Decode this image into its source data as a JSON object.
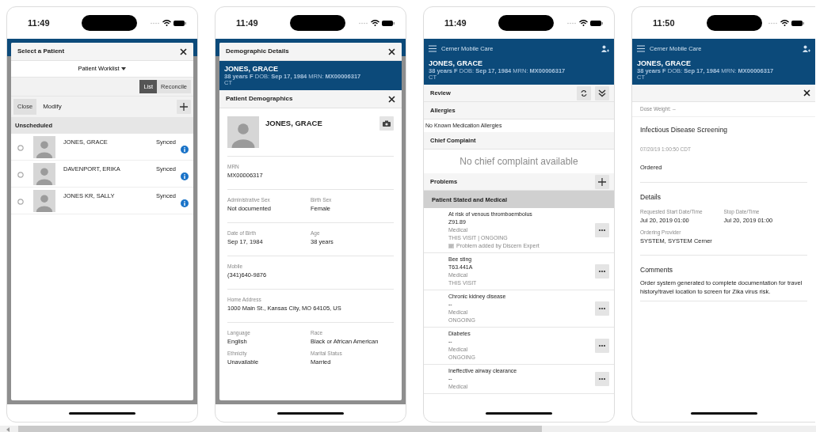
{
  "screens": [
    {
      "kind": "patient_select",
      "time": "11:49",
      "modal": {
        "title": "Select a Patient",
        "worklist": "Patient Worklist",
        "view_tabs": [
          {
            "label": "List",
            "selected": true
          },
          {
            "label": "Reconcile",
            "selected": false
          }
        ],
        "close": "Close",
        "modify": "Modify",
        "group": "Unscheduled",
        "patients": [
          {
            "name": "JONES, GRACE",
            "status": "Synced"
          },
          {
            "name": "DAVENPORT, ERIKA",
            "status": "Synced"
          },
          {
            "name": "JONES KR, SALLY",
            "status": "Synced"
          }
        ]
      }
    },
    {
      "kind": "demographics",
      "time": "11:49",
      "modal_title": "Demographic Details",
      "banner": {
        "name": "JONES, GRACE",
        "details": "**38 years F** DOB: **Sep 17, 1984** MRN: **MX00006317**",
        "extra": "CT"
      },
      "section_title": "Patient Demographics",
      "patient_name": "JONES, GRACE",
      "sections": [
        [
          [
            {
              "label": "MRN",
              "value": "MX00006317"
            }
          ]
        ],
        [
          [
            {
              "label": "Administrative Sex",
              "value": "Not documented"
            },
            {
              "label": "Birth Sex",
              "value": "Female"
            }
          ]
        ],
        [
          [
            {
              "label": "Date of Birth",
              "value": "Sep 17, 1984"
            },
            {
              "label": "Age",
              "value": "38 years"
            }
          ]
        ],
        [
          [
            {
              "label": "Mobile",
              "value": "(341)640-9876"
            }
          ]
        ],
        [
          [
            {
              "label": "Home Address",
              "value": "1000 Main St., Kansas City, MO 64105, US"
            }
          ]
        ],
        [
          [
            {
              "label": "Language",
              "value": "English"
            },
            {
              "label": "Race",
              "value": "Black or African American"
            }
          ],
          [
            {
              "label": "Ethnicity",
              "value": "Unavailable"
            },
            {
              "label": "Marital Status",
              "value": "Married"
            }
          ]
        ]
      ]
    },
    {
      "kind": "review",
      "time": "11:49",
      "app_title": "Cerner Mobile Care",
      "banner": {
        "name": "JONES, GRACE",
        "details": "**38 years F** DOB: **Sep 17, 1984** MRN: **MX00006317**",
        "extra": "CT"
      },
      "review_title": "Review",
      "allergies_title": "Allergies",
      "allergies_text": "No Known Medication Allergies",
      "chief_complaint_title": "Chief Complaint",
      "chief_complaint_empty": "No chief complaint available",
      "problems_title": "Problems",
      "problem_group": "Patient Stated and Medical",
      "problems": [
        {
          "name": "At risk of venous thromboembolus",
          "code": "Z91.89",
          "type": "Medical",
          "status": "THIS VISIT | ONGOING",
          "note": "Problem added by Discern Expert"
        },
        {
          "name": "Bee sting",
          "code": "T63.441A",
          "type": "Medical",
          "status": "THIS VISIT"
        },
        {
          "name": "Chronic kidney disease",
          "code": "--",
          "type": "Medical",
          "status": "ONGOING"
        },
        {
          "name": "Diabetes",
          "code": "--",
          "type": "Medical",
          "status": "ONGOING"
        },
        {
          "name": "Ineffective airway clearance",
          "code": "--",
          "type": "Medical"
        }
      ]
    },
    {
      "kind": "order_detail",
      "time": "11:50",
      "app_title": "Cerner Mobile Care",
      "banner": {
        "name": "JONES, GRACE",
        "details": "**38 years F** DOB: **Sep 17, 1984** MRN: **MX00006317**",
        "extra": "CT"
      },
      "dose_weight": "Dose Weight: --",
      "order_name": "Infectious Disease Screening",
      "order_time": "07/20/19 1:00:50 CDT",
      "order_status": "Ordered",
      "details_title": "Details",
      "details": [
        [
          {
            "label": "Requested Start Date/Time",
            "value": "Jul 20, 2019 01:00"
          },
          {
            "label": "Stop Date/Time",
            "value": "Jul 20, 2019 01:00"
          }
        ],
        [
          {
            "label": "Ordering Provider",
            "value": "SYSTEM, SYSTEM Cerner"
          }
        ]
      ],
      "comments_title": "Comments",
      "comment": "Order system generated to complete documentation for travel history/travel location to screen for Zika virus risk."
    }
  ]
}
